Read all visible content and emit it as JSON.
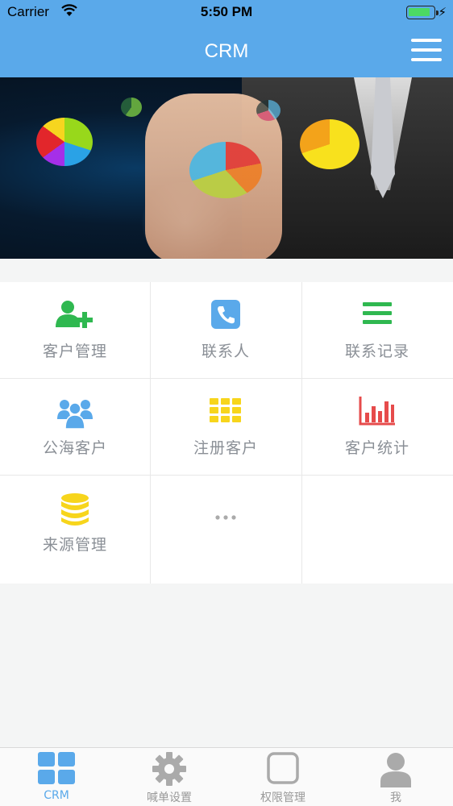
{
  "status_bar": {
    "carrier": "Carrier",
    "time": "5:50 PM"
  },
  "nav": {
    "title": "CRM",
    "menu_icon": "hamburger-menu-icon"
  },
  "banner": {
    "slide_count": 4,
    "active_slide": 1
  },
  "grid": {
    "items": [
      {
        "label": "客户管理",
        "icon": "add-user-icon",
        "color": "#2fb850"
      },
      {
        "label": "联系人",
        "icon": "phone-icon",
        "color": "#5aa9ea"
      },
      {
        "label": "联系记录",
        "icon": "list-icon",
        "color": "#2fb850"
      },
      {
        "label": "公海客户",
        "icon": "group-icon",
        "color": "#5aa9ea"
      },
      {
        "label": "注册客户",
        "icon": "grid-icon",
        "color": "#f7d51c"
      },
      {
        "label": "客户统计",
        "icon": "bar-chart-icon",
        "color": "#e64b4b"
      },
      {
        "label": "来源管理",
        "icon": "database-icon",
        "color": "#f7d51c"
      },
      {
        "label": "",
        "icon": "more-dots-icon",
        "color": "#aaaaaa"
      }
    ]
  },
  "tabbar": {
    "items": [
      {
        "label": "CRM",
        "icon": "dashboard-icon",
        "active": true
      },
      {
        "label": "喊单设置",
        "icon": "gear-icon",
        "active": false
      },
      {
        "label": "权限管理",
        "icon": "square-icon",
        "active": false
      },
      {
        "label": "我",
        "icon": "person-icon",
        "active": false
      }
    ],
    "active_color": "#5aa9ea",
    "inactive_color": "#aaaaaa"
  },
  "colors": {
    "nav_bar": "#5aa9ea",
    "background": "#f4f5f5"
  }
}
